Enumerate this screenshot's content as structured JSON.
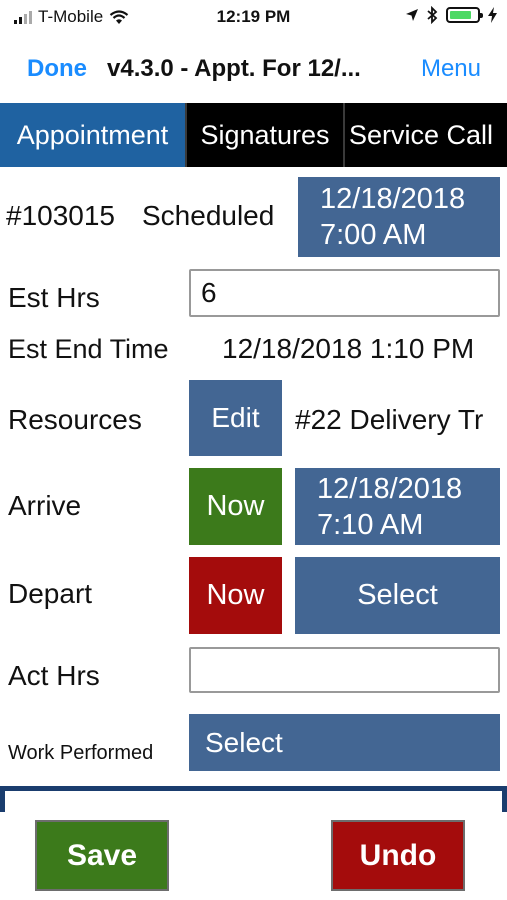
{
  "status_bar": {
    "carrier": "T-Mobile",
    "time": "12:19 PM",
    "battery_color": "#4cd964"
  },
  "nav": {
    "done_label": "Done",
    "title": "v4.3.0 - Appt. For 12/...",
    "menu_label": "Menu"
  },
  "tabs": [
    {
      "label": "Appointment",
      "active": true
    },
    {
      "label": "Signatures",
      "active": false
    },
    {
      "label": "Service Call",
      "active": false
    }
  ],
  "appointment": {
    "number": "#103015",
    "status": "Scheduled",
    "scheduled_date": "12/18/2018",
    "scheduled_time": "7:00 AM"
  },
  "est_hrs": {
    "label": "Est Hrs",
    "value": "6"
  },
  "est_end": {
    "label": "Est End Time",
    "value": "12/18/2018 1:10 PM"
  },
  "resources": {
    "label": "Resources",
    "edit_label": "Edit",
    "value": "#22 Delivery Tr"
  },
  "arrive": {
    "label": "Arrive",
    "now_label": "Now",
    "date": "12/18/2018",
    "time": "7:10 AM"
  },
  "depart": {
    "label": "Depart",
    "now_label": "Now",
    "select_label": "Select"
  },
  "act_hrs": {
    "label": "Act Hrs",
    "value": ""
  },
  "work_performed": {
    "label": "Work Performed",
    "select_label": "Select"
  },
  "footer": {
    "save_label": "Save",
    "undo_label": "Undo"
  },
  "colors": {
    "link_blue": "#1a8cff",
    "tab_active": "#1f62a1",
    "button_blue": "#436693",
    "now_green": "#3c7a1b",
    "now_red": "#a40c0c"
  }
}
